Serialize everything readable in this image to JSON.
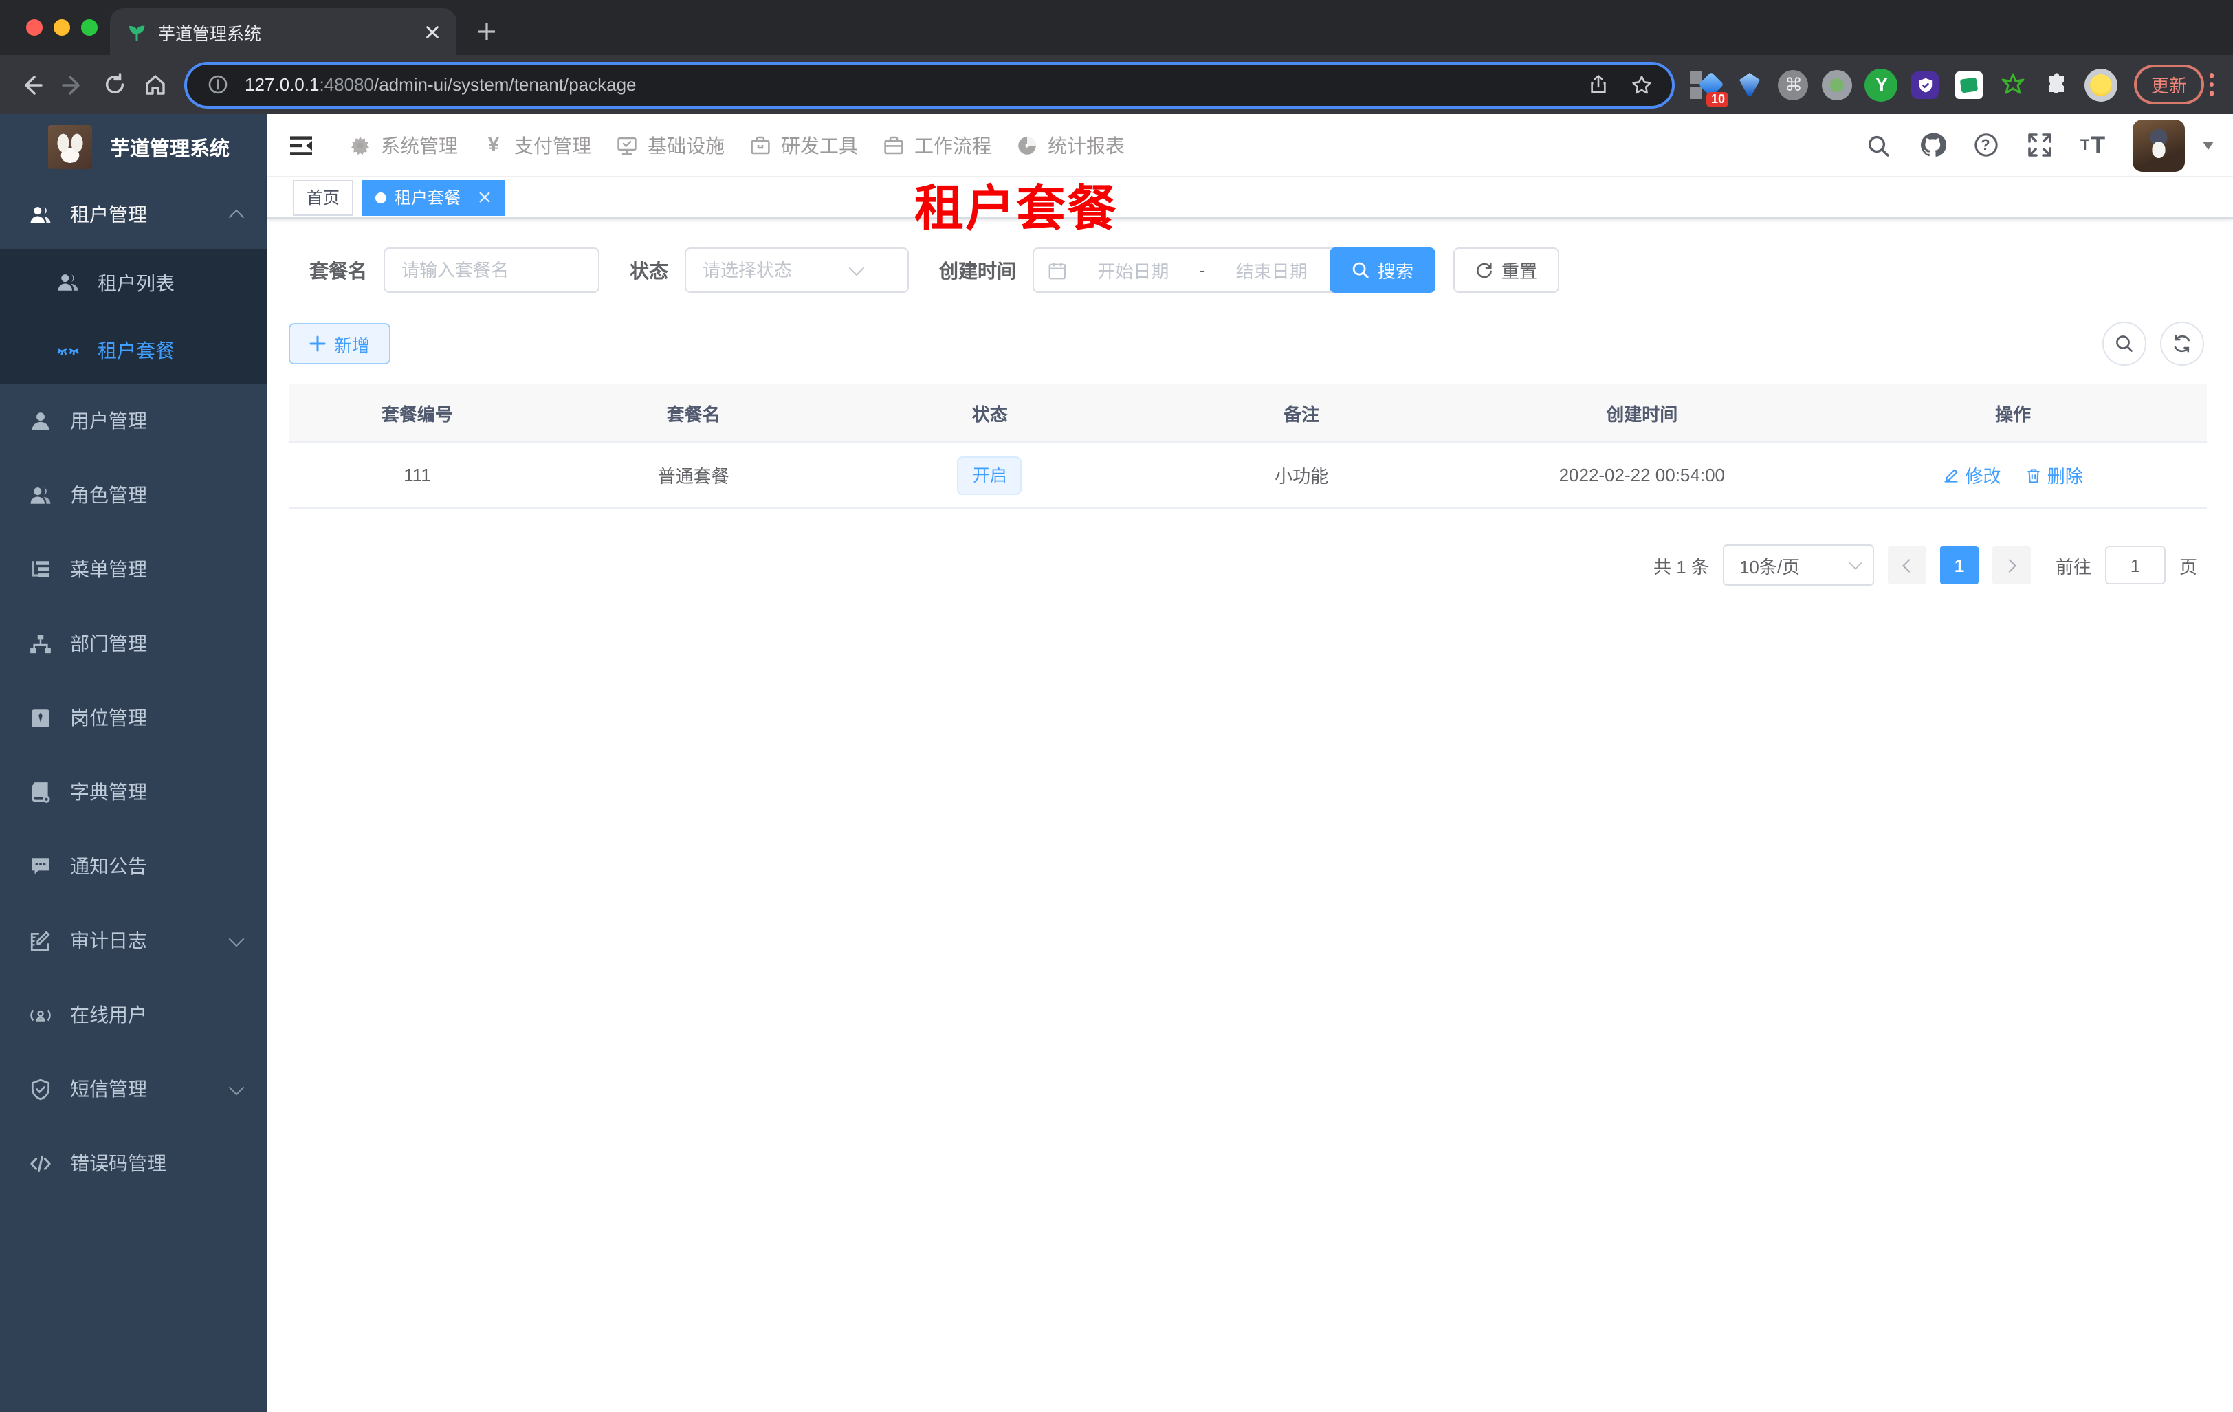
{
  "colors": {
    "accent": "#409eff",
    "sidebar_bg": "#304156",
    "submenu_bg": "#1f2d3d",
    "tag_open_bg": "#ecf5ff",
    "annotation_red": "#f70000",
    "chrome_update": "#f08579"
  },
  "browser": {
    "tab_title": "芋道管理系统",
    "url_host": "127.0.0.1",
    "url_port": ":48080",
    "url_path": "/admin-ui/system/tenant/package",
    "ext_badge": "10",
    "ext_y": "Y",
    "update_label": "更新"
  },
  "icons": {
    "pay_glyph": "¥",
    "cmd_glyph": "⌘",
    "help_glyph": "?",
    "fontsize_small": "T",
    "fontsize_large": "T"
  },
  "sidebar": {
    "logo_title": "芋道管理系统",
    "items": [
      {
        "label": "租户管理",
        "icon": "peoples"
      },
      {
        "label": "租户列表",
        "icon": "peoples"
      },
      {
        "label": "租户套餐",
        "icon": "eyelash"
      },
      {
        "label": "用户管理",
        "icon": "user"
      },
      {
        "label": "角色管理",
        "icon": "peoples"
      },
      {
        "label": "菜单管理",
        "icon": "tree-table"
      },
      {
        "label": "部门管理",
        "icon": "tree"
      },
      {
        "label": "岗位管理",
        "icon": "post"
      },
      {
        "label": "字典管理",
        "icon": "dict"
      },
      {
        "label": "通知公告",
        "icon": "message"
      },
      {
        "label": "审计日志",
        "icon": "log"
      },
      {
        "label": "在线用户",
        "icon": "online"
      },
      {
        "label": "短信管理",
        "icon": "sms-shield"
      },
      {
        "label": "错误码管理",
        "icon": "code"
      }
    ]
  },
  "topnav": {
    "items": [
      {
        "label": "系统管理",
        "icon": "gear"
      },
      {
        "label": "支付管理",
        "icon": "yen"
      },
      {
        "label": "基础设施",
        "icon": "monitor-check"
      },
      {
        "label": "研发工具",
        "icon": "toolbox"
      },
      {
        "label": "工作流程",
        "icon": "briefcase"
      },
      {
        "label": "统计报表",
        "icon": "dashboard"
      }
    ]
  },
  "tags": {
    "home": "首页",
    "active": "租户套餐"
  },
  "annotation": "租户套餐",
  "filters": {
    "name_label": "套餐名",
    "name_placeholder": "请输入套餐名",
    "status_label": "状态",
    "status_placeholder": "请选择状态",
    "date_label": "创建时间",
    "date_start": "开始日期",
    "date_sep": "-",
    "date_end": "结束日期",
    "search_label": "搜索",
    "reset_label": "重置"
  },
  "toolbar": {
    "add_label": "新增"
  },
  "table": {
    "headers": [
      "套餐编号",
      "套餐名",
      "状态",
      "备注",
      "创建时间",
      "操作"
    ],
    "rows": [
      {
        "id": "111",
        "name": "普通套餐",
        "status": "开启",
        "remark": "小功能",
        "created_at": "2022-02-22 00:54:00",
        "edit_label": "修改",
        "delete_label": "删除"
      }
    ]
  },
  "pagination": {
    "total": "共 1 条",
    "page_size": "10条/页",
    "current_page": "1",
    "goto_label": "前往",
    "goto_value": "1",
    "page_unit": "页"
  }
}
